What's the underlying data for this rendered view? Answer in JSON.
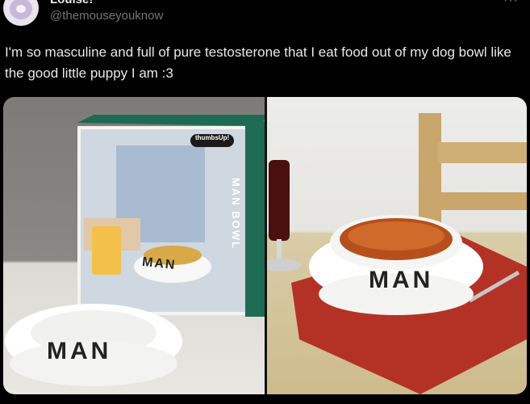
{
  "tweet": {
    "display_name": "Louise!",
    "handle": "@themouseyouknow",
    "more_label": "···",
    "text": "I'm so masculine and full of pure testosterone that I eat food out of my dog bowl like the good little puppy I am :3"
  },
  "media": {
    "left_photo": {
      "box_brand": "thumbsUp!",
      "box_side_label": "MAN BOWL",
      "box_top_label": "MAN BOWL",
      "box_bowl_label": "MAN",
      "front_bowl_label": "MAN"
    },
    "right_photo": {
      "bowl_label": "MAN"
    }
  },
  "colors": {
    "background": "#000000",
    "text": "#e7e9ea",
    "secondary_text": "#71767b"
  }
}
